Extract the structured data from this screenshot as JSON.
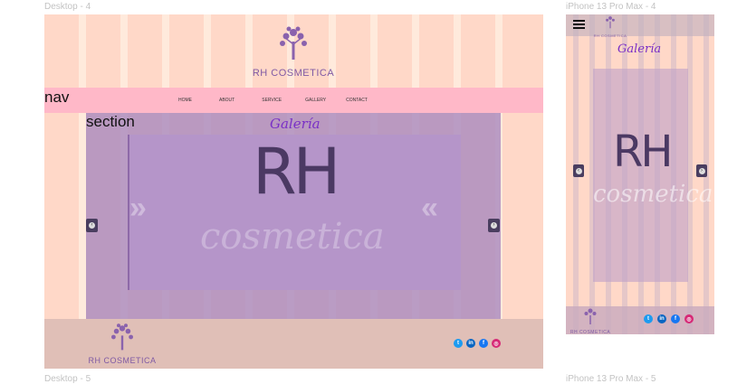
{
  "frames": {
    "desktop_top_label": "Desktop - 4",
    "desktop_bottom_label": "Desktop - 5",
    "mobile_top_label": "iPhone 13 Pro Max - 4",
    "mobile_bottom_label": "iPhone 13 Pro Max - 5"
  },
  "brand": {
    "name": "RH COSMETICA",
    "mark": "RH",
    "script": "cosmetica"
  },
  "nav": {
    "tag": "nav",
    "items": [
      "HOME",
      "ABOUT",
      "SERVICE",
      "GALLERY",
      "CONTACT"
    ]
  },
  "section": {
    "tag": "section",
    "title": "Galería"
  },
  "mobile": {
    "title": "Galería"
  },
  "social": [
    {
      "icon": "twitter-icon",
      "glyph": "t",
      "color": "#1d9bf0"
    },
    {
      "icon": "linkedin-icon",
      "glyph": "in",
      "color": "#0a66c2"
    },
    {
      "icon": "facebook-icon",
      "glyph": "f",
      "color": "#1877f2"
    },
    {
      "icon": "instagram-icon",
      "glyph": "◎",
      "color": "#d62976"
    }
  ],
  "colors": {
    "frame_bg": "#ffd8c8",
    "nav_bg": "#ffb8c8",
    "accent_purple": "#7a30c6",
    "brand_purple": "#7f5aa4"
  }
}
